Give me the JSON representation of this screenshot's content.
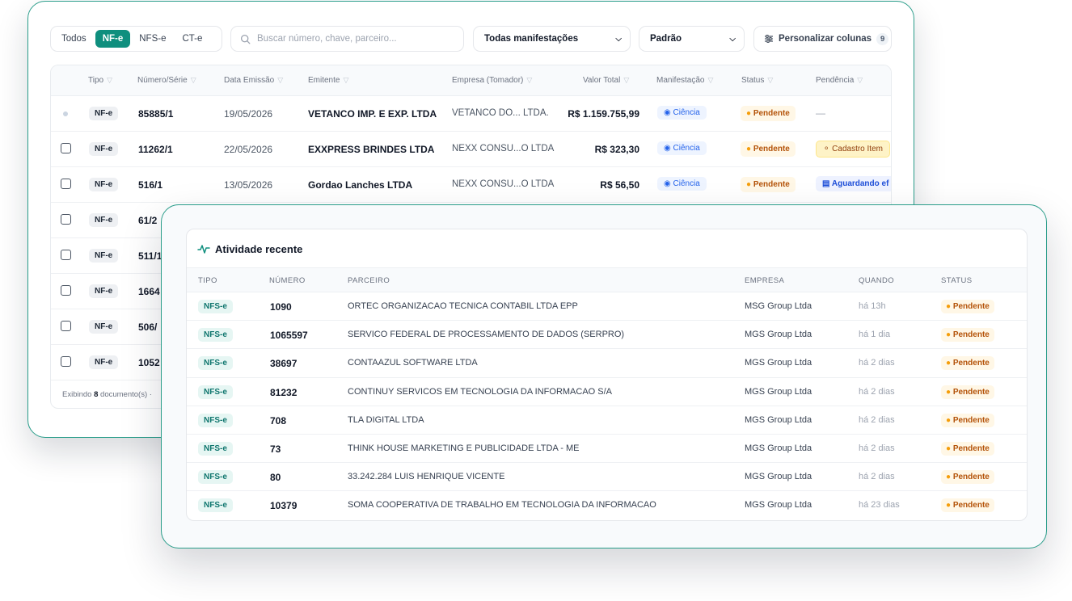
{
  "filters": {
    "types": [
      "Todos",
      "NF-e",
      "NFS-e",
      "CT-e"
    ],
    "active_type": "NF-e",
    "search_placeholder": "Buscar número, chave, parceiro...",
    "manifestacao_select": "Todas manifestações",
    "view_select": "Padrão",
    "columns_button": "Personalizar colunas",
    "columns_count": "9"
  },
  "docs_table": {
    "headers": [
      "Tipo",
      "Número/Série",
      "Data Emissão",
      "Emitente",
      "Empresa (Tomador)",
      "Valor Total",
      "Manifestação",
      "Status",
      "Pendência"
    ],
    "rows": [
      {
        "tipo": "NF-e",
        "numero": "85885/1",
        "data": "19/05/2026",
        "emitente": "VETANCO IMP. E EXP. LTDA",
        "empresa": "VETANCO DO... LTDA.",
        "valor": "R$ 1.159.755,99",
        "manifestacao": "Ciência",
        "status": "Pendente",
        "pendencia": "—"
      },
      {
        "tipo": "NF-e",
        "numero": "11262/1",
        "data": "22/05/2026",
        "emitente": "EXXPRESS BRINDES LTDA",
        "empresa": "NEXX CONSU...O LTDA",
        "valor": "R$ 323,30",
        "manifestacao": "Ciência",
        "status": "Pendente",
        "pendencia": "Cadastro Item"
      },
      {
        "tipo": "NF-e",
        "numero": "516/1",
        "data": "13/05/2026",
        "emitente": "Gordao Lanches LTDA",
        "empresa": "NEXX CONSU...O LTDA",
        "valor": "R$ 56,50",
        "manifestacao": "Ciência",
        "status": "Pendente",
        "pendencia": "Aguardando ef"
      },
      {
        "tipo": "NF-e",
        "numero": "61/2"
      },
      {
        "tipo": "NF-e",
        "numero": "511/1"
      },
      {
        "tipo": "NF-e",
        "numero": "1664"
      },
      {
        "tipo": "NF-e",
        "numero": "506/"
      },
      {
        "tipo": "NF-e",
        "numero": "1052"
      }
    ],
    "footer_prefix": "Exibindo",
    "footer_count": "8",
    "footer_suffix": "documento(s) ·"
  },
  "activity": {
    "title": "Atividade recente",
    "headers": [
      "TIPO",
      "NÚMERO",
      "PARCEIRO",
      "EMPRESA",
      "QUANDO",
      "STATUS"
    ],
    "rows": [
      {
        "tipo": "NFS-e",
        "numero": "1090",
        "parceiro": "ORTEC ORGANIZACAO TECNICA CONTABIL LTDA EPP",
        "empresa": "MSG Group Ltda",
        "quando": "há 13h",
        "status": "Pendente"
      },
      {
        "tipo": "NFS-e",
        "numero": "1065597",
        "parceiro": "SERVICO FEDERAL DE PROCESSAMENTO DE DADOS (SERPRO)",
        "empresa": "MGS Group Ltda",
        "quando": "há 1 dia",
        "status": "Pendente"
      },
      {
        "tipo": "NFS-e",
        "numero": "38697",
        "parceiro": "CONTAAZUL SOFTWARE LTDA",
        "empresa": "MGS Group Ltda",
        "quando": "há 2 dias",
        "status": "Pendente"
      },
      {
        "tipo": "NFS-e",
        "numero": "81232",
        "parceiro": "CONTINUY SERVICOS EM TECNOLOGIA DA INFORMACAO S/A",
        "empresa": "MGS Group Ltda",
        "quando": "há 2 dias",
        "status": "Pendente"
      },
      {
        "tipo": "NFS-e",
        "numero": "708",
        "parceiro": "TLA DIGITAL LTDA",
        "empresa": "MGS Group Ltda",
        "quando": "há 2 dias",
        "status": "Pendente"
      },
      {
        "tipo": "NFS-e",
        "numero": "73",
        "parceiro": "THINK HOUSE MARKETING E PUBLICIDADE LTDA - ME",
        "empresa": "MGS Group Ltda",
        "quando": "há 2 dias",
        "status": "Pendente"
      },
      {
        "tipo": "NFS-e",
        "numero": "80",
        "parceiro": "33.242.284 LUIS HENRIQUE VICENTE",
        "empresa": "MGS Group Ltda",
        "quando": "há 2 dias",
        "status": "Pendente"
      },
      {
        "tipo": "NFS-e",
        "numero": "10379",
        "parceiro": "SOMA COOPERATIVA DE TRABALHO EM TECNOLOGIA DA INFORMACAO",
        "empresa": "MGS Group Ltda",
        "quando": "há 23 dias",
        "status": "Pendente"
      }
    ]
  },
  "colors": {
    "accent": "#0f8f7e",
    "border": "#2a9d8a",
    "pending": "#b45309",
    "info": "#2563eb"
  }
}
